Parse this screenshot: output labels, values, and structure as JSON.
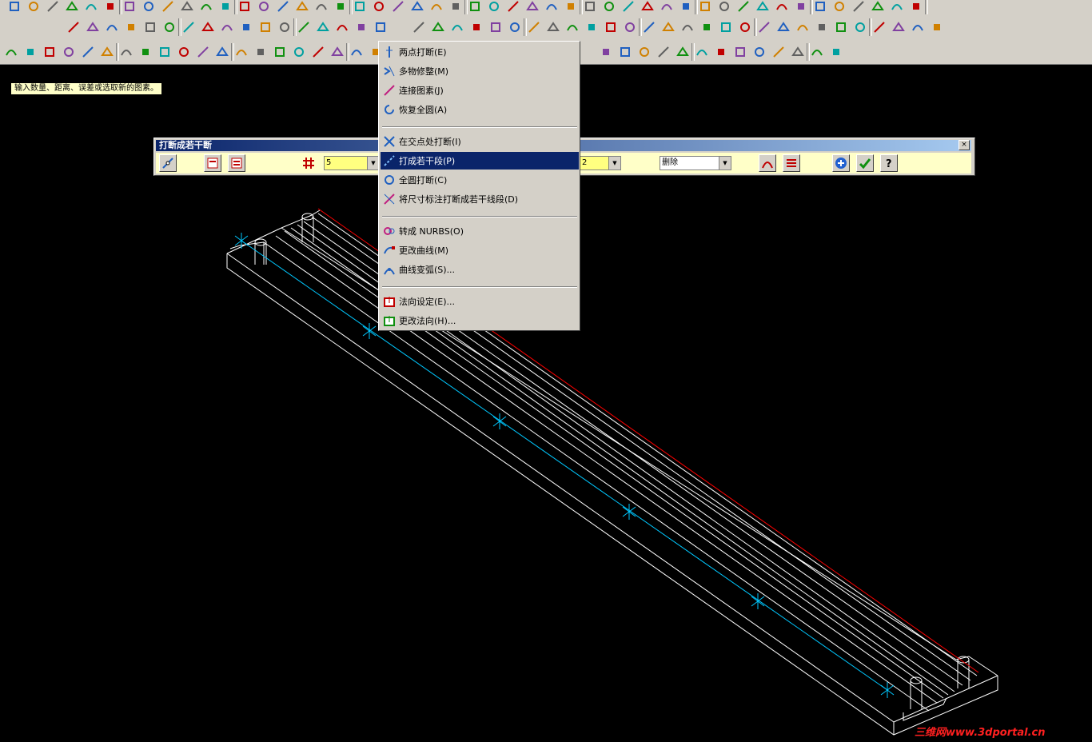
{
  "status_prompt": "输入数量、距离、误差或选取新的图素。",
  "dialog": {
    "title": "打断成若干断",
    "close_label": "×",
    "segments_value": "5",
    "tolerance_value": "2",
    "mode_value": "删除"
  },
  "context_menu": {
    "items": [
      {
        "label": "两点打断(E)",
        "icon": "break-two-points-icon"
      },
      {
        "label": "多物修整(M)",
        "icon": "trim-many-icon"
      },
      {
        "label": "连接图素(J)",
        "icon": "join-entities-icon"
      },
      {
        "label": "恢复全圆(A)",
        "icon": "restore-circle-icon"
      },
      {
        "label": "在交点处打断(I)",
        "icon": "break-at-intersection-icon"
      },
      {
        "label": "打成若干段(P)",
        "icon": "break-into-segments-icon",
        "selected": true
      },
      {
        "label": "全圆打断(C)",
        "icon": "break-circle-icon"
      },
      {
        "label": "将尺寸标注打断成若干线段(D)",
        "icon": "break-dimension-icon"
      },
      {
        "label": "转成 NURBS(O)",
        "icon": "convert-nurbs-icon"
      },
      {
        "label": "更改曲线(M)",
        "icon": "modify-curve-icon"
      },
      {
        "label": "曲线变弧(S)...",
        "icon": "curve-to-arc-icon"
      },
      {
        "label": "法向设定(E)...",
        "icon": "normal-set-icon"
      },
      {
        "label": "更改法向(H)...",
        "icon": "change-normal-icon"
      }
    ]
  },
  "watermark": "三维网www.3dportal.cn",
  "colors": {
    "toolbar_bg": "#d4d0c8",
    "menu_highlight": "#0a246a",
    "wireframe": "#ffffff",
    "construction_line": "#00c8ff",
    "edge_red": "#ff0000",
    "dialog_body": "#ffffc8"
  }
}
